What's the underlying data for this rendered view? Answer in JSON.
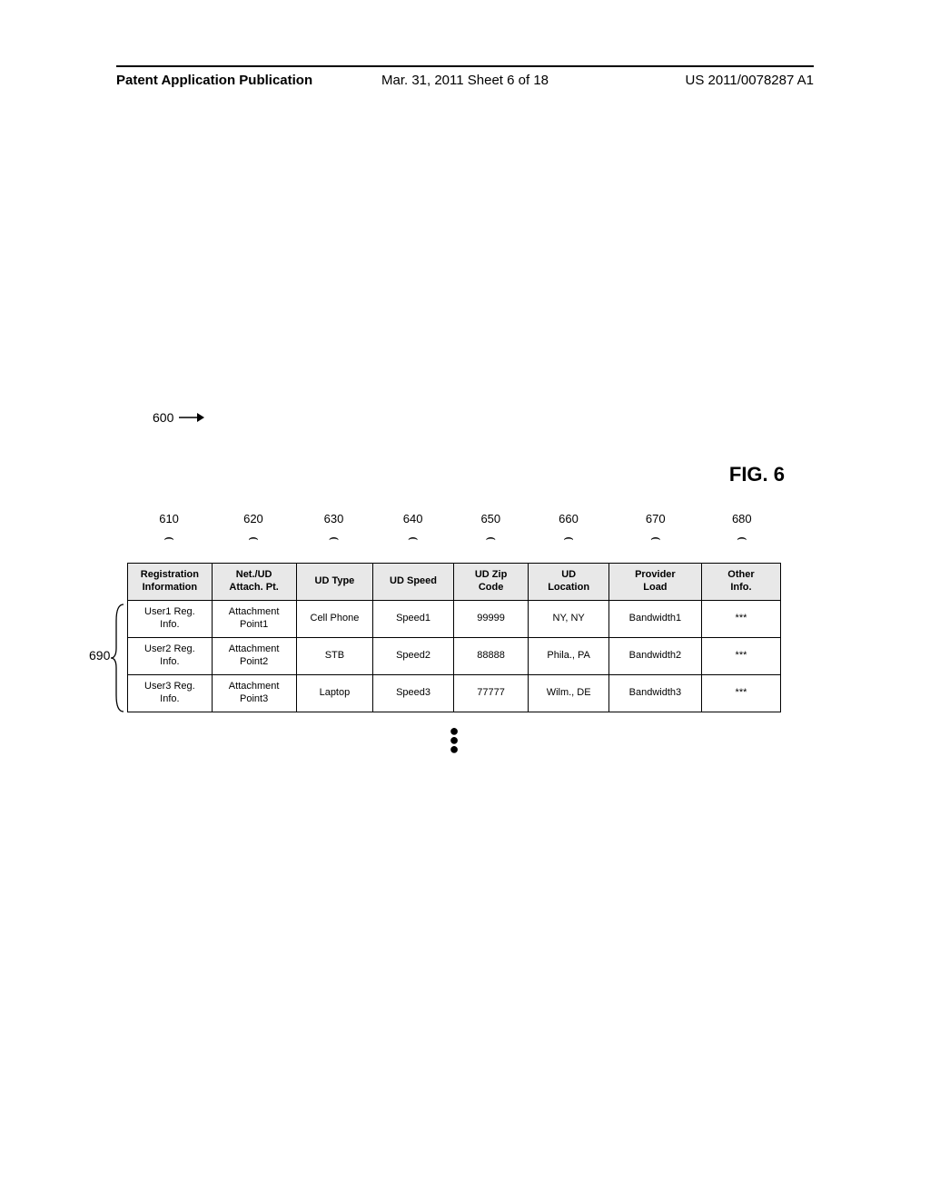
{
  "header": {
    "left": "Patent Application Publication",
    "mid": "Mar. 31, 2011   Sheet 6 of 18",
    "right": "US 2011/0078287 A1"
  },
  "figure": {
    "ref_label": "600",
    "title": "FIG. 6",
    "row_group_label": "690",
    "col_labels": [
      "610",
      "620",
      "630",
      "640",
      "650",
      "660",
      "670",
      "680"
    ],
    "headers": [
      "Registration\nInformation",
      "Net./UD\nAttach. Pt.",
      "UD Type",
      "UD Speed",
      "UD Zip\nCode",
      "UD\nLocation",
      "Provider\nLoad",
      "Other\nInfo."
    ],
    "rows": [
      [
        "User1 Reg.\nInfo.",
        "Attachment\nPoint1",
        "Cell Phone",
        "Speed1",
        "99999",
        "NY, NY",
        "Bandwidth1",
        "***"
      ],
      [
        "User2 Reg.\nInfo.",
        "Attachment\nPoint2",
        "STB",
        "Speed2",
        "88888",
        "Phila., PA",
        "Bandwidth2",
        "***"
      ],
      [
        "User3 Reg.\nInfo.",
        "Attachment\nPoint3",
        "Laptop",
        "Speed3",
        "77777",
        "Wilm., DE",
        "Bandwidth3",
        "***"
      ]
    ]
  },
  "chart_data": {
    "type": "table",
    "title": "FIG. 6",
    "columns": [
      "Registration Information",
      "Net./UD Attach. Pt.",
      "UD Type",
      "UD Speed",
      "UD Zip Code",
      "UD Location",
      "Provider Load",
      "Other Info."
    ],
    "column_refs": [
      "610",
      "620",
      "630",
      "640",
      "650",
      "660",
      "670",
      "680"
    ],
    "row_group_ref": "690",
    "rows": [
      {
        "Registration Information": "User1 Reg. Info.",
        "Net./UD Attach. Pt.": "Attachment Point1",
        "UD Type": "Cell Phone",
        "UD Speed": "Speed1",
        "UD Zip Code": "99999",
        "UD Location": "NY, NY",
        "Provider Load": "Bandwidth1",
        "Other Info.": "***"
      },
      {
        "Registration Information": "User2 Reg. Info.",
        "Net./UD Attach. Pt.": "Attachment Point2",
        "UD Type": "STB",
        "UD Speed": "Speed2",
        "UD Zip Code": "88888",
        "UD Location": "Phila., PA",
        "Provider Load": "Bandwidth2",
        "Other Info.": "***"
      },
      {
        "Registration Information": "User3 Reg. Info.",
        "Net./UD Attach. Pt.": "Attachment Point3",
        "UD Type": "Laptop",
        "UD Speed": "Speed3",
        "UD Zip Code": "77777",
        "UD Location": "Wilm., DE",
        "Provider Load": "Bandwidth3",
        "Other Info.": "***"
      }
    ]
  }
}
